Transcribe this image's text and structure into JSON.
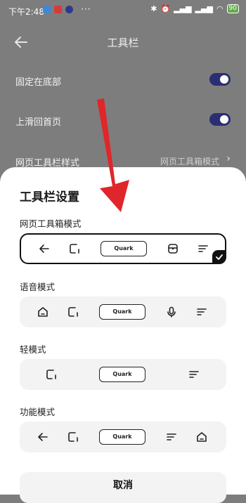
{
  "status_bar": {
    "time": "下午2:48",
    "more": "···",
    "battery": "90"
  },
  "header": {
    "title": "工具栏"
  },
  "settings": {
    "pin_bottom": "固定在底部",
    "swipe_home": "上滑回首页",
    "toolbar_style": "网页工具栏样式",
    "toolbar_style_value": "网页工具箱模式"
  },
  "sheet": {
    "title": "工具栏设置",
    "modes": [
      {
        "label": "网页工具箱模式",
        "logo": "Quark",
        "selected": true
      },
      {
        "label": "语音模式",
        "logo": "Quark",
        "selected": false
      },
      {
        "label": "轻模式",
        "logo": "Quark",
        "selected": false
      },
      {
        "label": "功能模式",
        "logo": "Quark",
        "selected": false
      }
    ],
    "cancel": "取消"
  },
  "colors": {
    "toggle_on": "#2b2f72",
    "arrow": "#e0262b",
    "dim_background": "#7d7d7d"
  }
}
